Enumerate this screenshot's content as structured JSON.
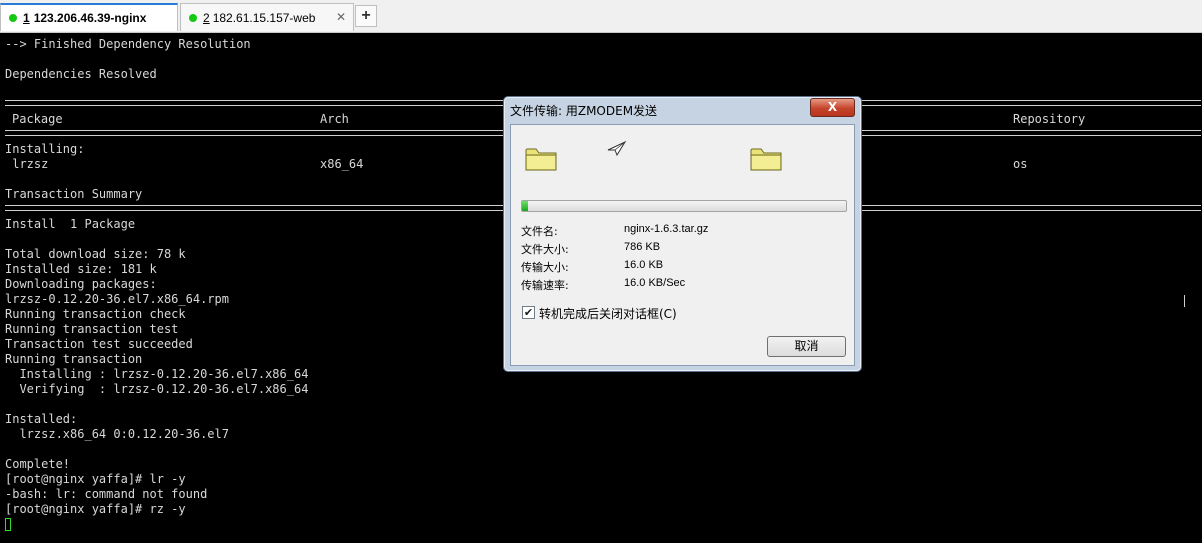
{
  "tabs": [
    {
      "index": "1",
      "label": "123.206.46.39-nginx",
      "active": true
    },
    {
      "index": "2",
      "label": "182.61.15.157-web",
      "active": false
    }
  ],
  "new_tab_label": "+",
  "terminal": {
    "lines": {
      "l0": "--> Finished Dependency Resolution",
      "l2": "Dependencies Resolved",
      "h_package": "Package",
      "h_arch": "Arch",
      "h_repo": "Repository",
      "l6": "Installing:",
      "pkg_name": " lrzsz",
      "pkg_arch": "x86_64",
      "pkg_repo": "os",
      "l9": "Transaction Summary",
      "l11": "Install  1 Package",
      "l13": "Total download size: 78 k",
      "l14": "Installed size: 181 k",
      "l15": "Downloading packages:",
      "l16": "lrzsz-0.12.20-36.el7.x86_64.rpm",
      "l17": "Running transaction check",
      "l18": "Running transaction test",
      "l19": "Transaction test succeeded",
      "l20": "Running transaction",
      "l21": "  Installing : lrzsz-0.12.20-36.el7.x86_64",
      "l22": "  Verifying  : lrzsz-0.12.20-36.el7.x86_64",
      "l24": "Installed:",
      "l25": "  lrzsz.x86_64 0:0.12.20-36.el7",
      "l27": "Complete!",
      "l28": "[root@nginx yaffa]# lr -y",
      "l29": "-bash: lr: command not found",
      "l30": "[root@nginx yaffa]# rz -y"
    }
  },
  "dialog": {
    "title": "文件传输: 用ZMODEM发送",
    "close_label": "X",
    "progress_fraction": 0.02,
    "fields": [
      {
        "label": "文件名:",
        "value": "nginx-1.6.3.tar.gz"
      },
      {
        "label": "文件大小:",
        "value": "786 KB"
      },
      {
        "label": "传输大小:",
        "value": "16.0 KB"
      },
      {
        "label": "传输速率:",
        "value": "16.0 KB/Sec"
      }
    ],
    "checkbox_label": "转机完成后关闭对话框(C)",
    "checkbox_checked": true,
    "cancel_label": "取消",
    "icons": [
      "folder-icon",
      "paper-plane-icon",
      "folder-icon"
    ]
  }
}
